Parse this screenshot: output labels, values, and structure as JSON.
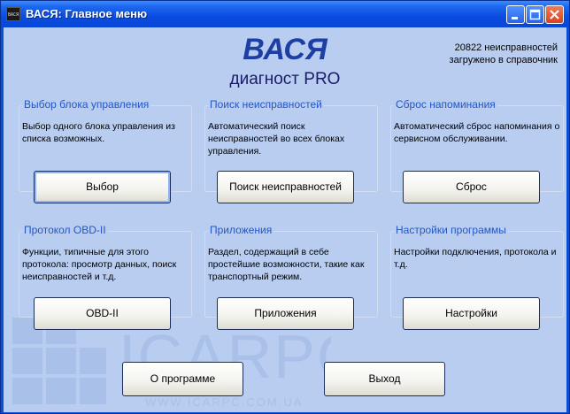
{
  "window": {
    "title": "ВАСЯ:  Главное меню",
    "app_icon_text": "ВАСЯ"
  },
  "header": {
    "logo_main": "ВАСЯ",
    "logo_sub": "диагност PRO",
    "status_line1": "20822 неисправностей",
    "status_line2": "загружено в справочник"
  },
  "groups": [
    {
      "title": "Выбор блока управления",
      "desc": "Выбор одного блока управления из списка возможных.",
      "button": "Выбор"
    },
    {
      "title": "Поиск неисправностей",
      "desc": "Автоматический поиск неисправностей во всех блоках управления.",
      "button": "Поиск неисправностей"
    },
    {
      "title": "Сброс напоминания",
      "desc": "Автоматический сброс напоминания о сервисном обслуживании.",
      "button": "Сброс"
    },
    {
      "title": "Протокол OBD-II",
      "desc": "Функции, типичные для этого протокола: просмотр данных, поиск неисправностей и т.д.",
      "button": "OBD-II"
    },
    {
      "title": "Приложения",
      "desc": "Раздел, содержащий в себе простейшие возможности, такие как транспортный режим.",
      "button": "Приложения"
    },
    {
      "title": "Настройки программы",
      "desc": "Настройки подключения, протокола и т.д.",
      "button": "Настройки"
    }
  ],
  "footer": {
    "about_button": "О программе",
    "exit_button": "Выход"
  },
  "watermark": {
    "text": "ICARPC",
    "url": "WWW.ICARPC.COM.UA"
  },
  "colors": {
    "titlebar": "#0a4be0",
    "client_bg": "#b8cdf0",
    "group_title": "#2457c4",
    "logo": "#1d3ea3"
  }
}
